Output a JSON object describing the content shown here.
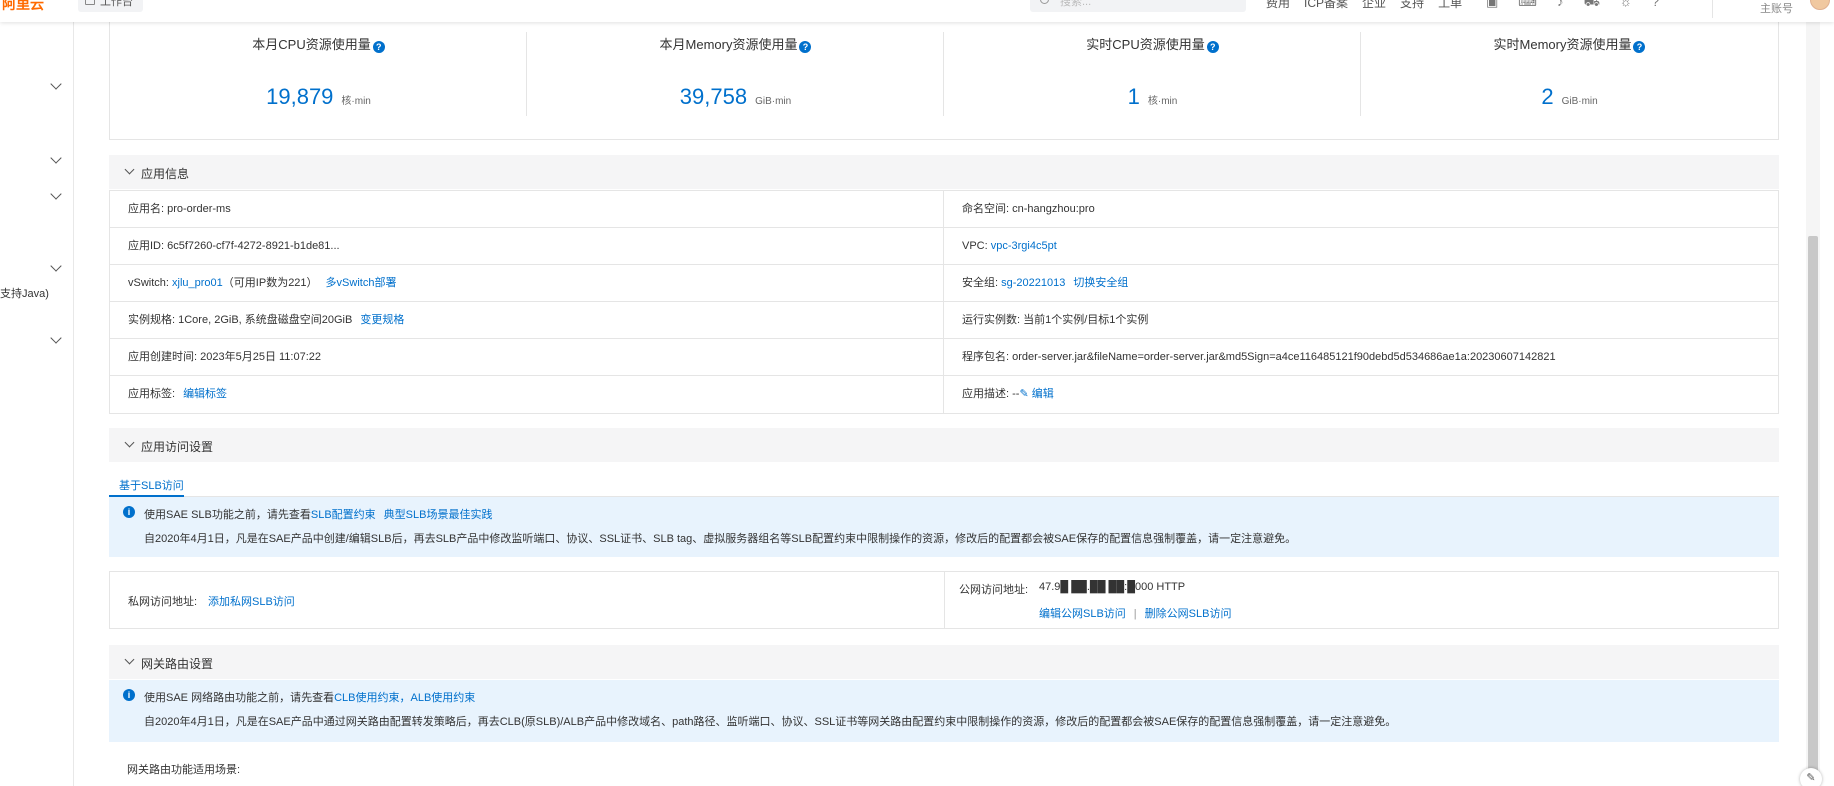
{
  "topbar": {
    "logo": "阿里云",
    "workbench": "工作台",
    "search_placeholder": "搜索...",
    "links": [
      "费用",
      "ICP备案",
      "企业",
      "支持",
      "工单"
    ],
    "account": "主账号"
  },
  "sidebar": {
    "java_item": "支持Java)"
  },
  "stats": [
    {
      "title": "本月CPU资源使用量",
      "value": "19,879",
      "unit": "核·min"
    },
    {
      "title": "本月Memory资源使用量",
      "value": "39,758",
      "unit": "GiB·min"
    },
    {
      "title": "实时CPU资源使用量",
      "value": "1",
      "unit": "核·min"
    },
    {
      "title": "实时Memory资源使用量",
      "value": "2",
      "unit": "GiB·min"
    }
  ],
  "app_info": {
    "section_title": "应用信息",
    "app_name_label": "应用名:",
    "app_name": "pro-order-ms",
    "namespace_label": "命名空间:",
    "namespace": "cn-hangzhou:pro",
    "app_id_label": "应用ID:",
    "app_id": "6c5f7260-cf7f-4272-8921-b1de81...",
    "vpc_label": "VPC:",
    "vpc": "vpc-3rgi4c5pt",
    "vswitch_label": "vSwitch:",
    "vswitch": "xjlu_pro01",
    "vswitch_ip": "（可用IP数为221）",
    "vswitch_deploy": "多vSwitch部署",
    "sg_label": "安全组:",
    "sg": "sg-20221013",
    "sg_switch": "切换安全组",
    "spec_label": "实例规格:",
    "spec": "1Core, 2GiB, 系统盘磁盘空间20GiB",
    "spec_change": "变更规格",
    "running_label": "运行实例数:",
    "running": "当前1个实例/目标1个实例",
    "created_label": "应用创建时间:",
    "created": "2023年5月25日 11:07:22",
    "package_label": "程序包名:",
    "package": "order-server.jar&fileName=order-server.jar&md5Sign=a4ce116485121f90debd5d534686ae1a:20230607142821",
    "tags_label": "应用标签:",
    "tags_edit": "编辑标签",
    "desc_label": "应用描述:",
    "desc_value": "--",
    "desc_edit": "编辑"
  },
  "access": {
    "section_title": "应用访问设置",
    "tab": "基于SLB访问",
    "notice_prefix": "使用SAE SLB功能之前，请先查看",
    "notice_link1": "SLB配置约束",
    "notice_link2": "典型SLB场景最佳实践",
    "notice_body": "自2020年4月1日，凡是在SAE产品中创建/编辑SLB后，再去SLB产品中修改监听端口、协议、SSL证书、SLB tag、虚拟服务器组名等SLB配置约束中限制操作的资源，修改后的配置都会被SAE保存的配置信息强制覆盖，请一定注意避免。",
    "private_label": "私网访问地址:",
    "private_add": "添加私网SLB访问",
    "public_label": "公网访问地址:",
    "public_value": "47.9█ ██.██ ██:█000   HTTP",
    "public_edit": "编辑公网SLB访问",
    "public_sep": "|",
    "public_delete": "删除公网SLB访问"
  },
  "gateway": {
    "section_title": "网关路由设置",
    "notice_prefix": "使用SAE 网络路由功能之前，请先查看",
    "notice_link1": "CLB使用约束",
    "notice_comma": "，",
    "notice_link2": "ALB使用约束",
    "notice_body": "自2020年4月1日，凡是在SAE产品中通过网关路由配置转发策略后，再去CLB(原SLB)/ALB产品中修改域名、path路径、监听端口、协议、SSL证书等网关路由配置约束中限制操作的资源，修改后的配置都会被SAE保存的配置信息强制覆盖，请一定注意避免。",
    "scenario_label": "网关路由功能适用场景:"
  },
  "colors": {
    "link": "#0070cc",
    "notice_bg": "#e8f3fd",
    "section_bg": "#f5f5f6",
    "brand": "#ff6a00"
  }
}
